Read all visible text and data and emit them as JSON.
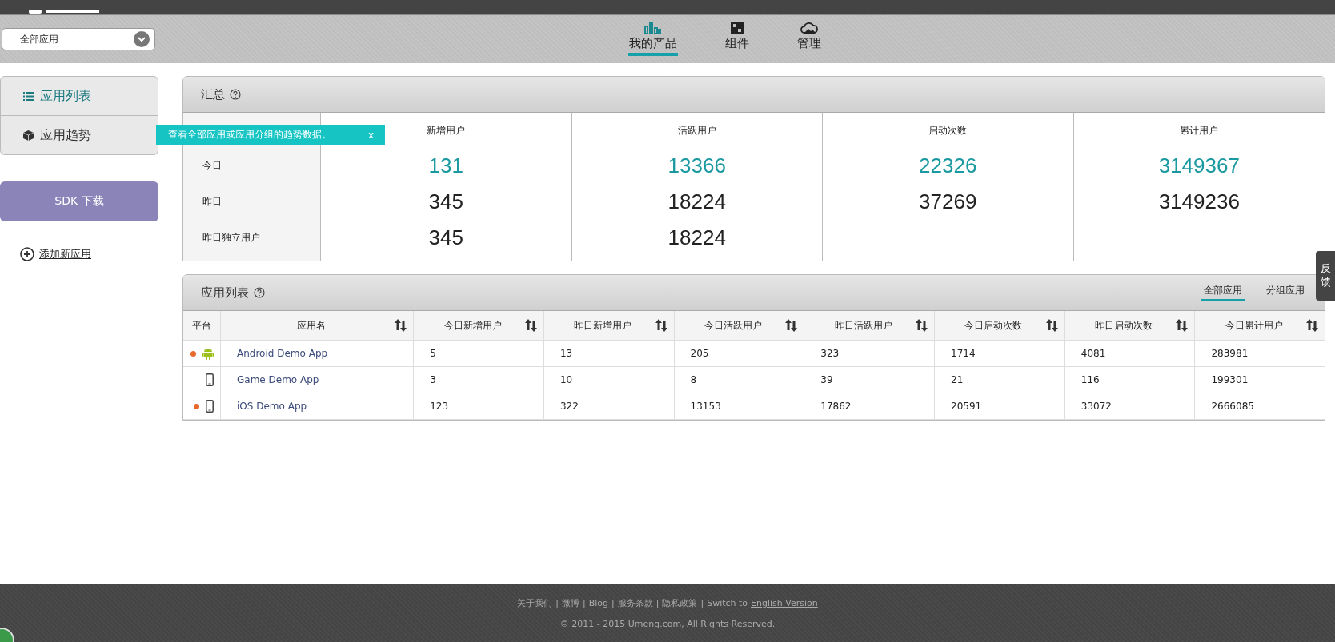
{
  "app_selector": {
    "value": "全部应用"
  },
  "nav_tabs": [
    {
      "label": "我的产品",
      "kind": "bars",
      "selected": true
    },
    {
      "label": "组件",
      "kind": "blocks",
      "selected": false
    },
    {
      "label": "管理",
      "kind": "cloud",
      "selected": false
    }
  ],
  "sidebar": {
    "items": [
      {
        "label": "应用列表",
        "kind": "list",
        "selected": true
      },
      {
        "label": "应用趋势",
        "kind": "cube",
        "selected": false
      }
    ],
    "tooltip": {
      "text": "查看全部应用或应用分组的趋势数据。",
      "close": "x"
    },
    "sdk_button": "SDK 下载",
    "add_link": "添加新应用"
  },
  "summary": {
    "title": "汇总",
    "row_labels": [
      "今日",
      "昨日",
      "昨日独立用户"
    ],
    "columns": [
      {
        "title": "新增用户",
        "today": "131",
        "yesterday": "345",
        "unique": "345"
      },
      {
        "title": "活跃用户",
        "today": "13366",
        "yesterday": "18224",
        "unique": "18224"
      },
      {
        "title": "启动次数",
        "today": "22326",
        "yesterday": "37269"
      },
      {
        "title": "累计用户",
        "today": "3149367",
        "yesterday": "3149236"
      }
    ]
  },
  "app_list": {
    "title": "应用列表",
    "filters": [
      {
        "label": "全部应用",
        "selected": true
      },
      {
        "label": "分组应用",
        "selected": false
      }
    ],
    "columns": [
      "平台",
      "应用名",
      "今日新增用户",
      "昨日新增用户",
      "今日活跃用户",
      "昨日活跃用户",
      "今日启动次数",
      "昨日启动次数",
      "今日累计用户"
    ],
    "rows": [
      {
        "marked": true,
        "kind": "android",
        "cells": [
          "",
          "Android Demo App",
          "5",
          "13",
          "205",
          "323",
          "1714",
          "4081",
          "283981"
        ]
      },
      {
        "marked": false,
        "kind": "phone",
        "cells": [
          "",
          "Game Demo App",
          "3",
          "10",
          "8",
          "39",
          "21",
          "116",
          "199301"
        ]
      },
      {
        "marked": true,
        "kind": "phone",
        "cells": [
          "",
          "iOS Demo App",
          "123",
          "322",
          "13153",
          "17862",
          "20591",
          "33072",
          "2666085"
        ]
      }
    ]
  },
  "feedback_tab": [
    "反",
    "馈"
  ],
  "footer": {
    "links": [
      "关于我们",
      "微博",
      "Blog",
      "服务条款",
      "隐私政策"
    ],
    "separator": "|",
    "switch_text": "Switch to",
    "switch_link": "English Version",
    "copyright": "© 2011 - 2015 Umeng.com, All Rights Reserved."
  }
}
